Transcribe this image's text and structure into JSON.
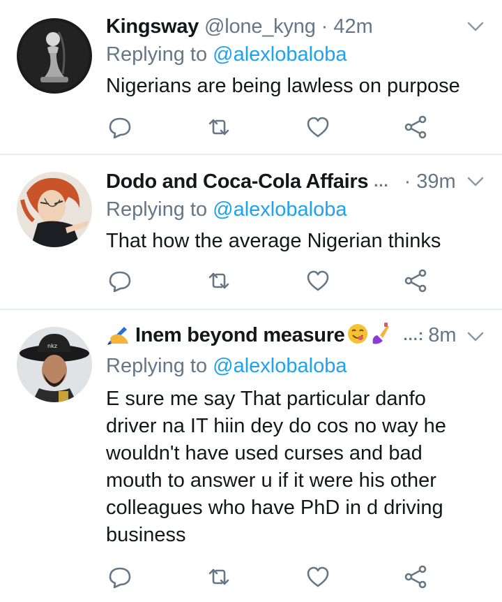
{
  "tweets": [
    {
      "name": "Kingsway",
      "handle": "@lone_kyng",
      "time": "· 42m",
      "reply_prefix": "Replying to ",
      "reply_to": "@alexlobaloba",
      "text": "Nigerians are being lawless on purpose",
      "avatar": "avatar-chess-pawn"
    },
    {
      "name": "Dodo and Coca-Cola Affairs",
      "ellipsis": "...",
      "time": "· 39m",
      "reply_prefix": "Replying to ",
      "reply_to": "@alexlobaloba",
      "text": "That how the average Nigerian thinks",
      "avatar": "avatar-anime-character"
    },
    {
      "name": "Inem beyond measure",
      "ellipsis": "...:",
      "time": "8m",
      "reply_prefix": "Replying to ",
      "reply_to": "@alexlobaloba",
      "text_lines": [
        "E sure me say That particular danfo",
        "driver na IT hiin dey do cos no way he",
        "wouldn't have used curses and bad",
        "mouth to answer u if it were his other",
        "colleagues who have PhD in d driving",
        "business"
      ],
      "avatar": "avatar-man-in-hat",
      "name_emojis": [
        "writing-hand-emoji",
        "yum-face-emoji",
        "nail-polish-emoji"
      ]
    }
  ],
  "actions": [
    "reply-icon",
    "retweet-icon",
    "like-icon",
    "share-icon"
  ],
  "colors": {
    "mention": "#1da1f2",
    "secondary": "#657786",
    "divider": "#e6ecf0",
    "text": "#14171a"
  }
}
